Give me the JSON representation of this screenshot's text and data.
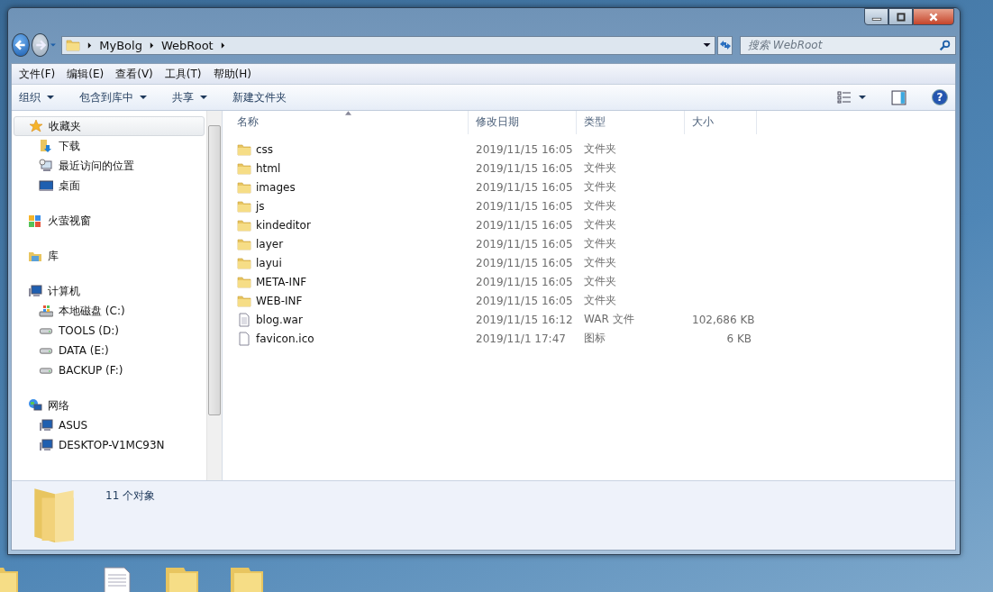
{
  "help_button": {
    "label": "?"
  },
  "address_bar": {
    "path": [
      "MyBolg",
      "WebRoot"
    ]
  },
  "search": {
    "placeholder": "搜索 WebRoot"
  },
  "menu_bar": [
    "文件(F)",
    "编辑(E)",
    "查看(V)",
    "工具(T)",
    "帮助(H)"
  ],
  "toolbar": [
    {
      "label": "组织",
      "dropdown": true
    },
    {
      "label": "包含到库中",
      "dropdown": true
    },
    {
      "label": "共享",
      "dropdown": true
    },
    {
      "label": "新建文件夹",
      "dropdown": false
    }
  ],
  "sidebar": {
    "groups": [
      {
        "label": "收藏夹",
        "kind": "star",
        "selected": true,
        "children": [
          {
            "label": "下载",
            "kind": "download"
          },
          {
            "label": "最近访问的位置",
            "kind": "recent"
          },
          {
            "label": "桌面",
            "kind": "desktop"
          }
        ]
      },
      {
        "label": "火萤视窗",
        "kind": "tiles",
        "selected": false
      },
      {
        "label": "库",
        "kind": "library",
        "selected": false
      },
      {
        "label": "计算机",
        "kind": "computer",
        "selected": false,
        "children": [
          {
            "label": "本地磁盘 (C:)",
            "kind": "sysdrive"
          },
          {
            "label": "TOOLS (D:)",
            "kind": "drive"
          },
          {
            "label": "DATA (E:)",
            "kind": "drive"
          },
          {
            "label": "BACKUP (F:)",
            "kind": "drive"
          }
        ]
      },
      {
        "label": "网络",
        "kind": "network",
        "selected": false,
        "children": [
          {
            "label": "ASUS",
            "kind": "computer"
          },
          {
            "label": "DESKTOP-V1MC93N",
            "kind": "computer"
          }
        ]
      }
    ]
  },
  "table": {
    "columns": [
      "名称",
      "修改日期",
      "类型",
      "大小"
    ],
    "rows": [
      {
        "name": "css",
        "date": "2019/11/15 16:05",
        "type": "文件夹",
        "kind": "folder"
      },
      {
        "name": "html",
        "date": "2019/11/15 16:05",
        "type": "文件夹",
        "kind": "folder"
      },
      {
        "name": "images",
        "date": "2019/11/15 16:05",
        "type": "文件夹",
        "kind": "folder"
      },
      {
        "name": "js",
        "date": "2019/11/15 16:05",
        "type": "文件夹",
        "kind": "folder"
      },
      {
        "name": "kindeditor",
        "date": "2019/11/15 16:05",
        "type": "文件夹",
        "kind": "folder"
      },
      {
        "name": "layer",
        "date": "2019/11/15 16:05",
        "type": "文件夹",
        "kind": "folder"
      },
      {
        "name": "layui",
        "date": "2019/11/15 16:05",
        "type": "文件夹",
        "kind": "folder"
      },
      {
        "name": "META-INF",
        "date": "2019/11/15 16:05",
        "type": "文件夹",
        "kind": "folder"
      },
      {
        "name": "WEB-INF",
        "date": "2019/11/15 16:05",
        "type": "文件夹",
        "kind": "folder"
      },
      {
        "name": "blog.war",
        "date": "2019/11/15 16:12",
        "type": "WAR 文件",
        "size": "102,686 KB",
        "kind": "archive"
      },
      {
        "name": "favicon.ico",
        "date": "2019/11/1 17:47",
        "type": "图标",
        "size": "6 KB",
        "kind": "file"
      }
    ]
  },
  "details_pane": {
    "text": "11 个对象"
  },
  "desktop_icons": [
    {
      "kind": "folder"
    },
    {
      "kind": "document"
    },
    {
      "kind": "folder"
    },
    {
      "kind": "folder"
    }
  ]
}
